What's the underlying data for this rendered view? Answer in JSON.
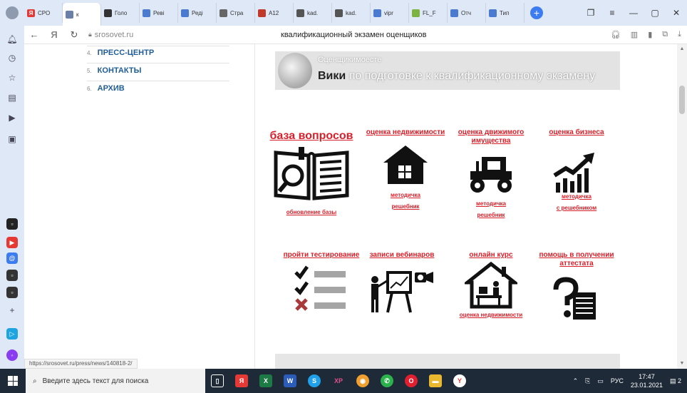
{
  "browser": {
    "tabs": [
      {
        "label": "СРО",
        "fav": "Я",
        "color": "#e53935"
      },
      {
        "label": "к",
        "fav": "",
        "color": "#6a80a8",
        "active": true
      },
      {
        "label": "Голо",
        "fav": "",
        "color": "#333"
      },
      {
        "label": "Реві",
        "fav": "",
        "color": "#4a7bd0"
      },
      {
        "label": "Реді",
        "fav": "",
        "color": "#4a7bd0"
      },
      {
        "label": "Стра",
        "fav": "",
        "color": "#666"
      },
      {
        "label": "А12",
        "fav": "",
        "color": "#c0392b"
      },
      {
        "label": "kad.",
        "fav": "",
        "color": "#555"
      },
      {
        "label": "kad.",
        "fav": "",
        "color": "#555"
      },
      {
        "label": "vipr",
        "fav": "",
        "color": "#4a7bd0"
      },
      {
        "label": "FL_F",
        "fav": "",
        "color": "#7cb342"
      },
      {
        "label": "Отч",
        "fav": "",
        "color": "#4a7bd0"
      },
      {
        "label": "Тип",
        "fav": "",
        "color": "#4a7bd0"
      }
    ],
    "url": "srosovet.ru",
    "page_title": "квалификационный экзамен оценщиков",
    "status_url": "https://srosovet.ru/press/news/140818-2/"
  },
  "menu": [
    {
      "num": "4.",
      "label": "ПРЕСС-ЦЕНТР"
    },
    {
      "num": "5.",
      "label": "КОНТАКТЫ"
    },
    {
      "num": "6.",
      "label": "АРХИВ"
    }
  ],
  "banner": {
    "top": "Оценщикимоесте",
    "wiki": "Вики",
    "rest": "по подготовке к квалификационному экзамену"
  },
  "grid": [
    {
      "title": "база вопросов",
      "subs": [
        "обновление базы"
      ],
      "icon": "book-search-icon",
      "big": true
    },
    {
      "title": "оценка недвижимости",
      "subs": [
        "методичка",
        "решебник"
      ],
      "icon": "house-icon"
    },
    {
      "title": "оценка движимого имущества",
      "subs": [
        "методичка",
        "решебник"
      ],
      "icon": "tractor-icon"
    },
    {
      "title": "оценка бизнеса",
      "subs": [
        "методичка",
        "с решебником"
      ],
      "icon": "growth-chart-icon"
    },
    {
      "title": "пройти тестирование",
      "subs": [],
      "icon": "checklist-icon"
    },
    {
      "title": "записи вебинаров",
      "subs": [],
      "icon": "presenter-icon"
    },
    {
      "title": "онлайн курс",
      "subs": [
        "оценка недвижимости"
      ],
      "icon": "home-office-icon"
    },
    {
      "title": "помощь в получении аттестата",
      "subs": [],
      "icon": "question-doc-icon"
    }
  ],
  "taskbar": {
    "search_placeholder": "Введите здесь текст для поиска",
    "lang": "РУС",
    "time": "17:47",
    "date": "23.01.2021",
    "notif_count": "2"
  }
}
